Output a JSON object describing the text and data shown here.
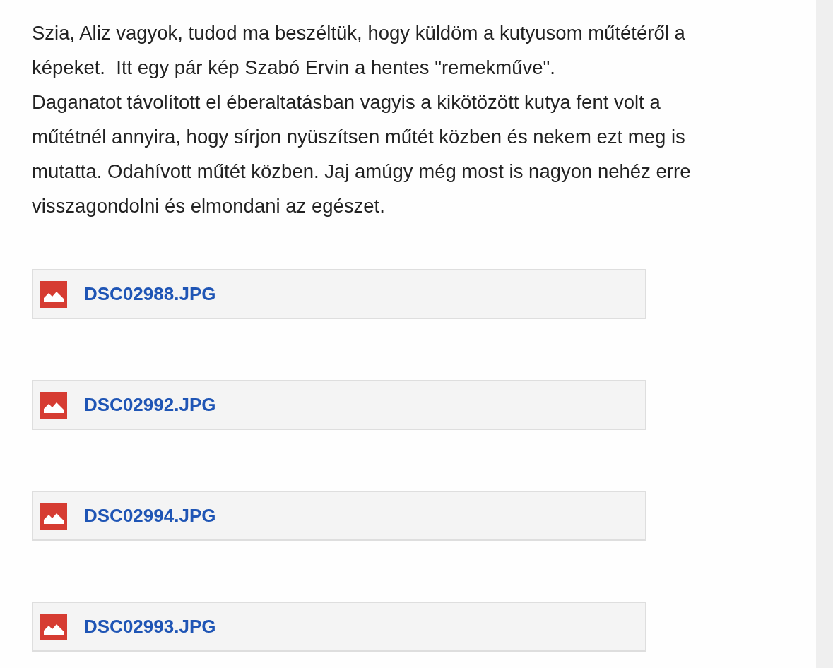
{
  "message": {
    "lines": [
      "Szia, Aliz vagyok, tudod ma beszéltük, hogy küldöm a kutyusom műtétéről a",
      "képeket.  Itt egy pár kép Szabó Ervin a hentes \"remekműve\".",
      "Daganatot távolított el éberaltatásban vagyis a kikötözött kutya fent volt a",
      "műtétnél annyira, hogy sírjon nyüszítsen műtét közben és nekem ezt meg is",
      "mutatta. Odahívott műtét közben. Jaj amúgy még most is nagyon nehéz erre",
      "visszagondolni és elmondani az egészet."
    ]
  },
  "attachments": [
    {
      "kind": "image",
      "name": "DSC02988.JPG"
    },
    {
      "kind": "image",
      "name": "DSC02992.JPG"
    },
    {
      "kind": "image",
      "name": "DSC02994.JPG"
    },
    {
      "kind": "image",
      "name": "DSC02993.JPG"
    }
  ]
}
